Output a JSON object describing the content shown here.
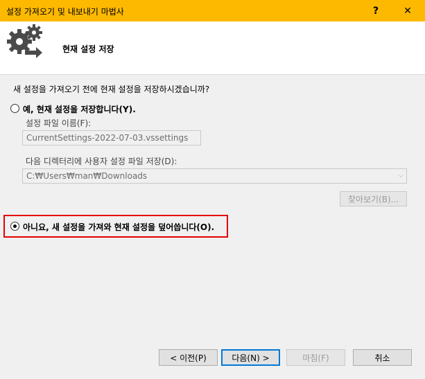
{
  "window": {
    "title": "설정 가져오기 및 내보내기 마법사",
    "help_label": "?",
    "close_label": "✕"
  },
  "header": {
    "title": "현재 설정 저장"
  },
  "body": {
    "question": "새 설정을 가져오기 전에 현재 설정을 저장하시겠습니까?",
    "option_yes_label": "예, 현재 설정을 저장합니다(Y).",
    "file_name_label": "설정 파일 이름(F):",
    "file_name_value": "CurrentSettings-2022-07-03.vssettings",
    "directory_label": "다음 디렉터리에 사용자 설정 파일 저장(D):",
    "directory_value": "C:₩Users₩man₩Downloads",
    "browse_label": "찾아보기(B)...",
    "option_no_label": "아니요, 새 설정을 가져와 현재 설정을 덮어씁니다(O).",
    "selected_option": "no"
  },
  "footer": {
    "prev_label": "< 이전(P)",
    "next_label": "다음(N) >",
    "finish_label": "마침(F)",
    "cancel_label": "취소"
  },
  "colors": {
    "titlebar": "#fcb900",
    "highlight": "#e30000",
    "focus": "#0078d7"
  }
}
